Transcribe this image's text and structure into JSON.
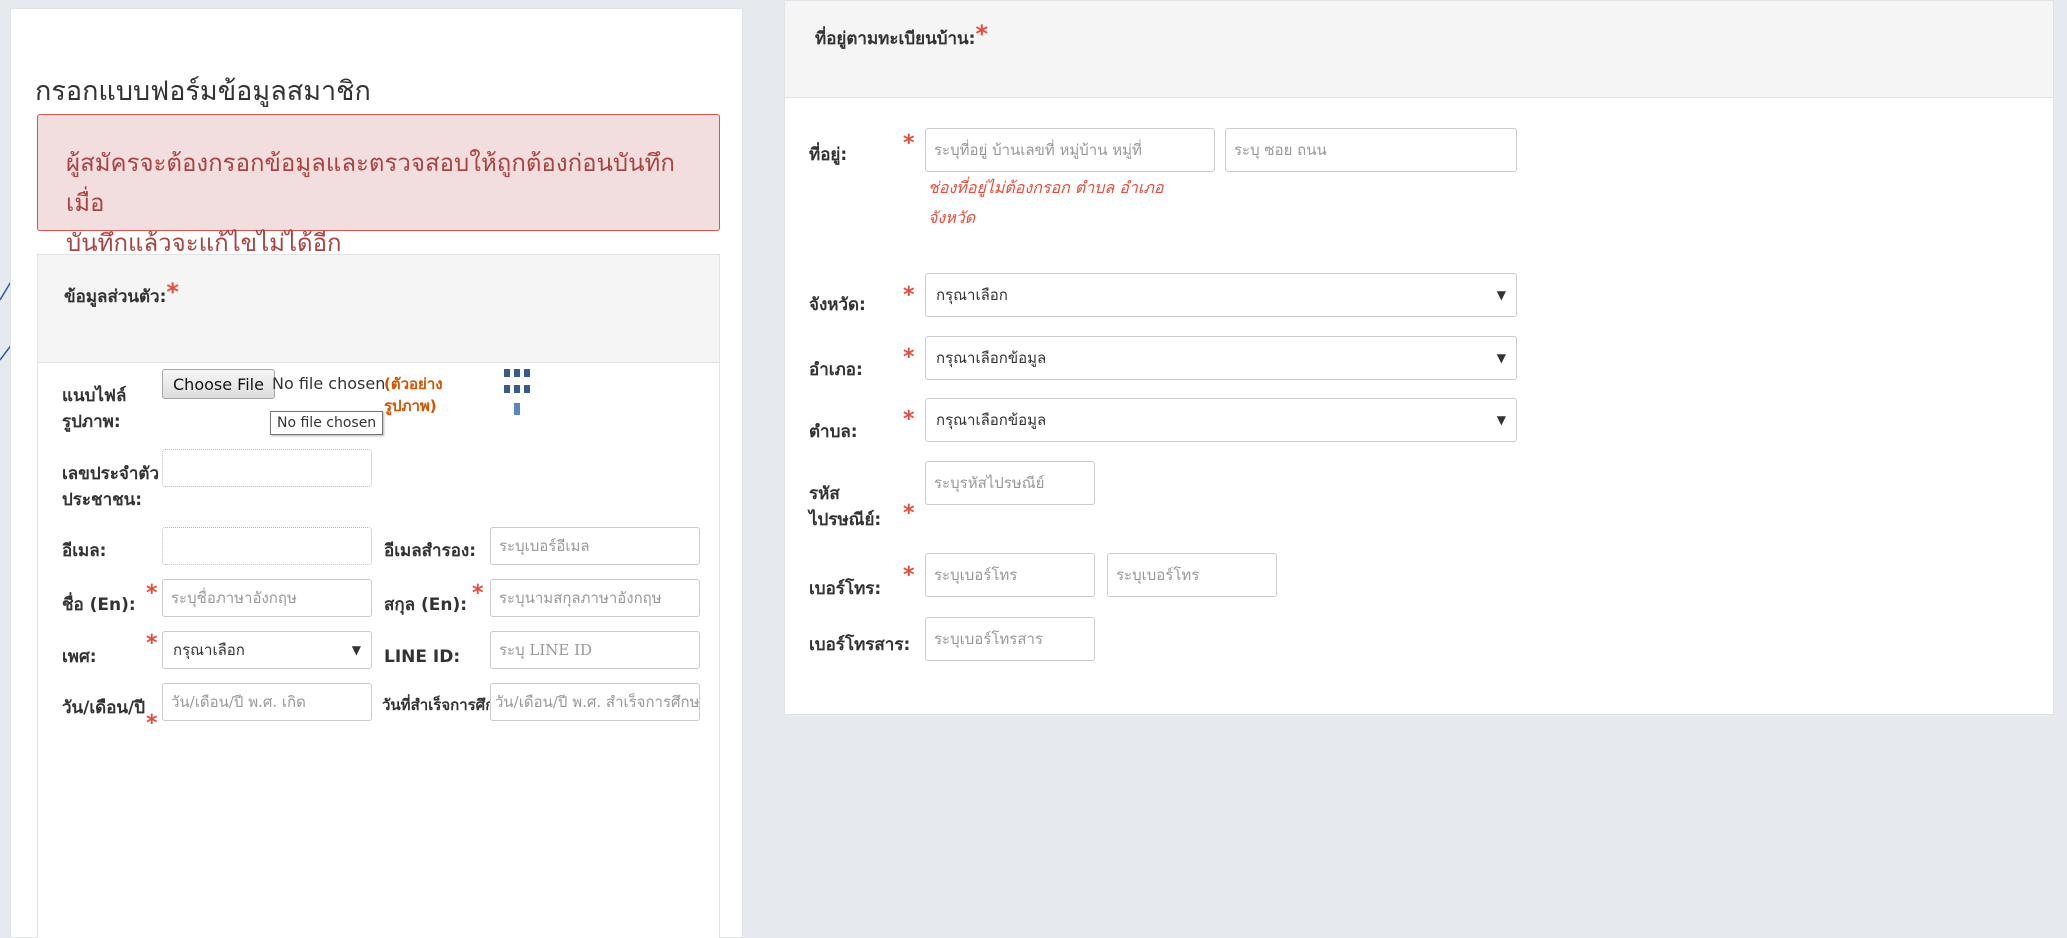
{
  "left": {
    "page_title": "กรอกแบบฟอร์มข้อมูลสมาชิก",
    "alert_line1": "ผู้สมัครจะต้องกรอกข้อมูลและตรวจสอบให้ถูกต้องก่อนบันทึกเมื่อ",
    "alert_line2": "บันทึกแล้วจะแก้ไขไม่ได้อีก",
    "card_title": "ข้อมูลส่วนตัว:",
    "required_mark": "*",
    "photo_label_1": "แนบไฟล์",
    "photo_label_2": "รูปภาพ:",
    "choose_file": "Choose File",
    "no_file": "No file chosen",
    "tooltip": "No file chosen",
    "example_1": "(ตัวอย่าง",
    "example_2": "รูปภาพ)",
    "id_label_1": "เลขประจำตัว",
    "id_label_2": "ประชาชน:",
    "email_label": "อีเมล:",
    "email2_label": "อีเมลสำรอง:",
    "email2_placeholder": "ระบุเบอร์อีเมล",
    "name_en_label": "ชื่อ (En):",
    "name_en_placeholder": "ระบุชื่อภาษาอังกฤษ",
    "surname_en_label": "สกุล (En):",
    "surname_en_placeholder": "ระบุนามสกุลภาษาอังกฤษ",
    "gender_label": "เพศ:",
    "gender_value": "กรุณาเลือก",
    "line_label": "LINE ID:",
    "line_placeholder": "ระบุ LINE ID",
    "dob_label": "วัน/เดือน/ปี",
    "dob_placeholder": "วัน/เดือน/ปี พ.ศ. เกิด",
    "grad_label": "วันที่สำเร็จการศึกษา",
    "grad_placeholder": "วัน/เดือน/ปี พ.ศ. สำเร็จการศึกษา"
  },
  "right": {
    "card_title": "ที่อยู่ตามทะเบียนบ้าน:",
    "address_label": "ที่อยู่:",
    "address_placeholder": "ระบุที่อยู่ บ้านเลขที่ หมู่บ้าน หมู่ที่",
    "road_placeholder": "ระบุ ซอย ถนน",
    "address_hint_1": "ช่องที่อยู่ไม่ต้องกรอก ตำบล อำเภอ",
    "address_hint_2": "จังหวัด",
    "province_label": "จังหวัด:",
    "province_value": "กรุณาเลือก",
    "district_label": "อำเภอ:",
    "district_value": "กรุณาเลือกข้อมูล",
    "subdistrict_label": "ตำบล:",
    "subdistrict_value": "กรุณาเลือกข้อมูล",
    "postcode_label_1": "รหัส",
    "postcode_label_2": "ไปรษณีย์:",
    "postcode_placeholder": "ระบุรหัสไปรษณีย์",
    "phone_label": "เบอร์โทร:",
    "phone_placeholder_1": "ระบุเบอร์โทร",
    "phone_placeholder_2": "ระบุเบอร์โทร",
    "fax_label": "เบอร์โทรสาร:",
    "fax_placeholder": "ระบุเบอร์โทรสาร"
  },
  "icons": {
    "dropdown": "chevron-down-icon"
  },
  "colors": {
    "required": "#e74c3c",
    "alert_bg": "#f2dede",
    "alert_border": "#d9534f",
    "alert_text": "#a94442",
    "hint": "#e74c3c",
    "example": "#d35400"
  }
}
